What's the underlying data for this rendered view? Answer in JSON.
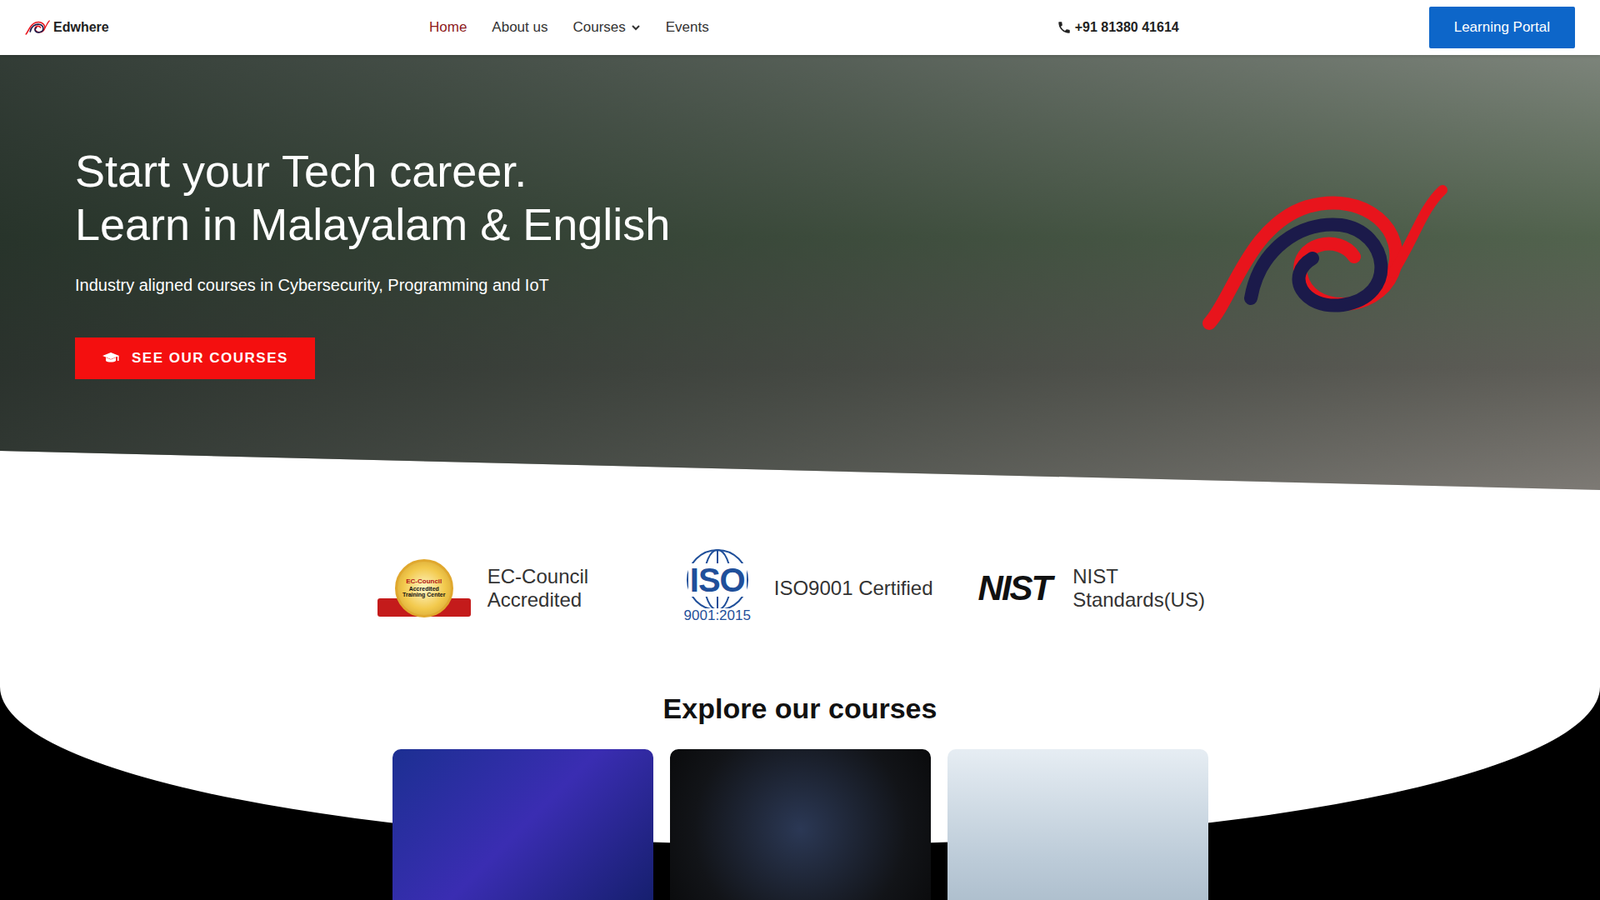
{
  "brand": {
    "name": "Edwhere"
  },
  "nav": [
    {
      "label": "Home",
      "selected": true,
      "kind": "link"
    },
    {
      "label": "About us",
      "selected": false,
      "kind": "link"
    },
    {
      "label": "Courses",
      "selected": false,
      "kind": "dropdown"
    },
    {
      "label": "Events",
      "selected": false,
      "kind": "link"
    }
  ],
  "phone": "+91 81380 41614",
  "portal_button": "Learning Portal",
  "hero": {
    "title_lines": [
      "Start your Tech career.",
      "Learn in Malayalam & English"
    ],
    "subtitle": "Industry aligned courses in Cybersecurity, Programming and IoT",
    "cta": "SEE OUR COURSES"
  },
  "accreditations": [
    {
      "label": "EC-Council Accredited",
      "kind": "eccouncil",
      "logo_text": [
        "EC-Council",
        "Accredited",
        "Training Center"
      ]
    },
    {
      "label": "ISO9001 Certified",
      "kind": "iso",
      "logo_text": [
        "ISO",
        "9001:2015"
      ]
    },
    {
      "label": "NIST Standards(US)",
      "kind": "nist",
      "logo_text": [
        "NIST"
      ]
    }
  ],
  "courses": {
    "heading": "Explore our courses",
    "cards": [
      {
        "kind": "cyber"
      },
      {
        "kind": "iot"
      },
      {
        "kind": "robotics"
      }
    ]
  }
}
